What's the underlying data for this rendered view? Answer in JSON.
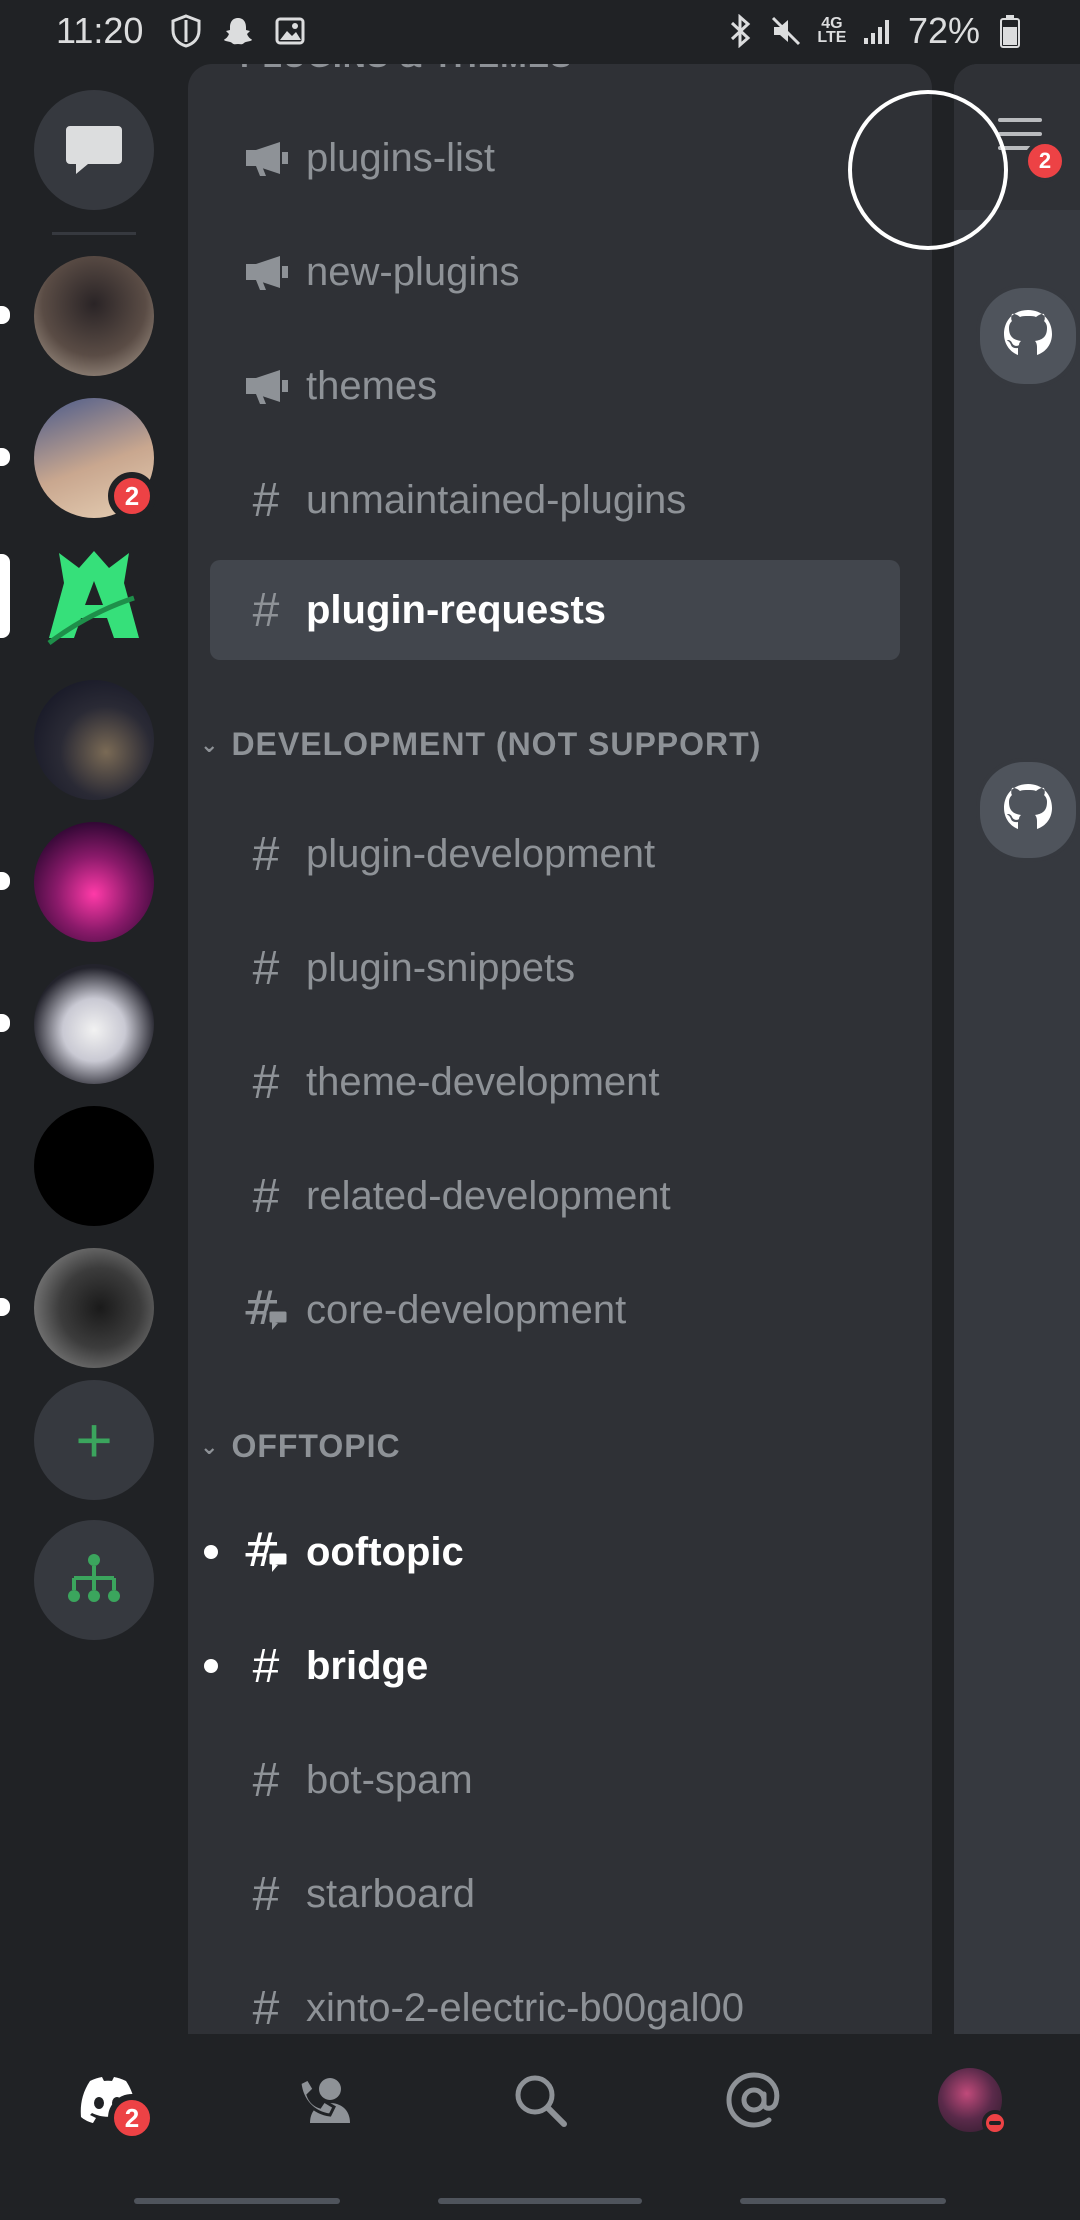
{
  "status_bar": {
    "time": "11:20",
    "battery": "72%",
    "left_icons": [
      "shield-icon",
      "snapchat-icon",
      "gallery-icon"
    ],
    "right_icons": [
      "bluetooth-icon",
      "mute-icon",
      "lte-icon",
      "signal-icon",
      "battery-icon"
    ]
  },
  "servers": {
    "badge_count": "2",
    "add_label": "+",
    "icons": [
      "dm-icon",
      "server-1",
      "server-2",
      "server-3",
      "server-4",
      "server-5",
      "server-6",
      "server-7",
      "server-8",
      "add-server-icon",
      "explore-icon"
    ]
  },
  "channel_list": {
    "partial_category": "PLUGINS & THEMES",
    "channels_top": [
      {
        "label": "plugins-list",
        "icon": "announcement-icon"
      },
      {
        "label": "new-plugins",
        "icon": "announcement-icon"
      },
      {
        "label": "themes",
        "icon": "announcement-icon"
      },
      {
        "label": "unmaintained-plugins",
        "icon": "hash-icon"
      },
      {
        "label": "plugin-requests",
        "icon": "hash-icon",
        "selected": true
      }
    ],
    "category_dev": "DEVELOPMENT (NOT SUPPORT)",
    "channels_dev": [
      {
        "label": "plugin-development",
        "icon": "hash-icon"
      },
      {
        "label": "plugin-snippets",
        "icon": "hash-icon"
      },
      {
        "label": "theme-development",
        "icon": "hash-icon"
      },
      {
        "label": "related-development",
        "icon": "hash-icon"
      },
      {
        "label": "core-development",
        "icon": "thread-channel-icon"
      }
    ],
    "category_off": "OFFTOPIC",
    "channels_off": [
      {
        "label": "ooftopic",
        "icon": "thread-channel-icon",
        "unread": true
      },
      {
        "label": "bridge",
        "icon": "hash-icon",
        "unread": true
      },
      {
        "label": "bot-spam",
        "icon": "hash-icon"
      },
      {
        "label": "starboard",
        "icon": "hash-icon"
      },
      {
        "label": "xinto-2-electric-b00gal00",
        "icon": "hash-icon"
      }
    ]
  },
  "peek": {
    "menu_badge": "2",
    "avatar_icons": [
      "github-icon",
      "github-icon"
    ]
  },
  "bottom_nav": {
    "home_badge": "2",
    "items": [
      "discord-home-icon",
      "friends-icon",
      "search-icon",
      "mentions-icon",
      "profile-avatar"
    ]
  },
  "colors": {
    "background": "#202225",
    "panel": "#2f3136",
    "selected": "#42464d",
    "muted": "#8e9297",
    "badge": "#ed4245",
    "green": "#3ba55d"
  }
}
